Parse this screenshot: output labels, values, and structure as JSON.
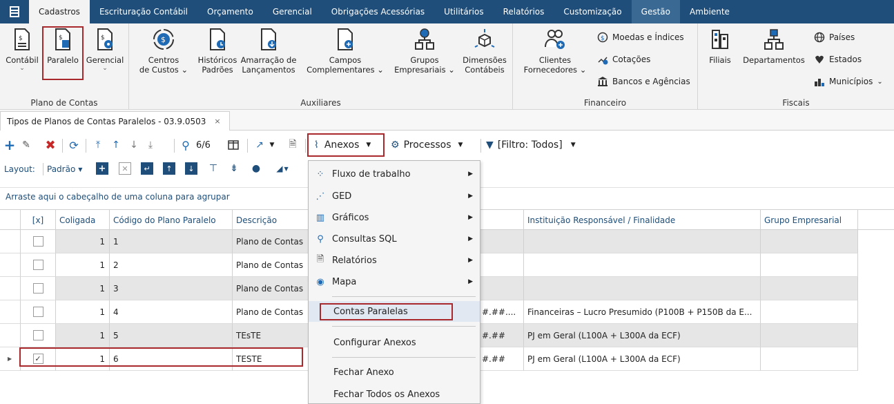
{
  "menu": [
    "Cadastros",
    "Escrituração Contábil",
    "Orçamento",
    "Gerencial",
    "Obrigações Acessórias",
    "Utilitários",
    "Relatórios",
    "Customização",
    "Gestão",
    "Ambiente"
  ],
  "ribbon": {
    "plano": {
      "label": "Plano de Contas",
      "contabil": "Contábil",
      "paralelo": "Paralelo",
      "gerencial": "Gerencial"
    },
    "auxiliares": {
      "label": "Auxiliares",
      "centros": [
        "Centros",
        "de Custos"
      ],
      "historicos": [
        "Históricos",
        "Padrões"
      ],
      "amarracao": [
        "Amarração de",
        "Lançamentos"
      ],
      "campos": [
        "Campos",
        "Complementares"
      ],
      "grupos": [
        "Grupos",
        "Empresariais"
      ],
      "dimensoes": [
        "Dimensões",
        "Contábeis"
      ]
    },
    "financeiro": {
      "label": "Financeiro",
      "clientes": [
        "Clientes",
        "Fornecedores"
      ],
      "moedas": "Moedas e Índices",
      "cotacoes": "Cotações",
      "bancos": "Bancos e Agências"
    },
    "fiscais": {
      "label": "Fiscais",
      "filiais": "Filiais",
      "departamentos": "Departamentos",
      "paises": "Países",
      "estados": "Estados",
      "municipios": "Municípios"
    }
  },
  "doc_tab": "Tipos de Planos de Contas Paralelos - 03.9.0503",
  "doc_tab_close": "×",
  "toolbar": {
    "count": "6/6",
    "anexos": "Anexos",
    "processos": "Processos",
    "filtro": "[Filtro: Todos]"
  },
  "layout": {
    "label": "Layout:",
    "value": "Padrão"
  },
  "group_hint": "Arraste aqui o cabeçalho de uma coluna para agrupar",
  "grid": {
    "headers": {
      "select": "[x]",
      "coligada": "Coligada",
      "codigo": "Código do Plano Paralelo",
      "descricao": "Descrição",
      "instituicao": "Instituição Responsável / Finalidade",
      "grupo": "Grupo Empresarial"
    },
    "rows": [
      {
        "coligada": "1",
        "codigo": "1",
        "descricao": "Plano de Contas",
        "mask": "",
        "instituicao": "",
        "checked": ""
      },
      {
        "coligada": "1",
        "codigo": "2",
        "descricao": "Plano de Contas",
        "mask": "",
        "instituicao": "",
        "checked": ""
      },
      {
        "coligada": "1",
        "codigo": "3",
        "descricao": "Plano de Contas",
        "mask": "",
        "instituicao": "",
        "checked": ""
      },
      {
        "coligada": "1",
        "codigo": "4",
        "descricao": "Plano de Contas",
        "mask": "#.##....",
        "instituicao": "Financeiras – Lucro Presumido (P100B + P150B da E...",
        "checked": ""
      },
      {
        "coligada": "1",
        "codigo": "5",
        "descricao": "TEsTE",
        "mask": "#.##",
        "instituicao": "PJ em Geral (L100A + L300A da ECF)",
        "checked": ""
      },
      {
        "coligada": "1",
        "codigo": "6",
        "descricao": "TESTE",
        "mask": "#.##",
        "instituicao": "PJ em Geral (L100A + L300A da ECF)",
        "checked": "✓"
      }
    ]
  },
  "dropdown": {
    "fluxo": "Fluxo de trabalho",
    "ged": "GED",
    "graficos": "Gráficos",
    "consultas": "Consultas SQL",
    "relatorios": "Relatórios",
    "mapa": "Mapa",
    "contas_paralelas": "Contas Paralelas",
    "configurar": "Configurar Anexos",
    "fechar": "Fechar Anexo",
    "fechar_todos": "Fechar Todos os Anexos"
  },
  "colors": {
    "menubar": "#1e4e79",
    "highlight": "#a8282b",
    "accent": "#1e4e79",
    "row_alt": "#e6e6e6"
  }
}
